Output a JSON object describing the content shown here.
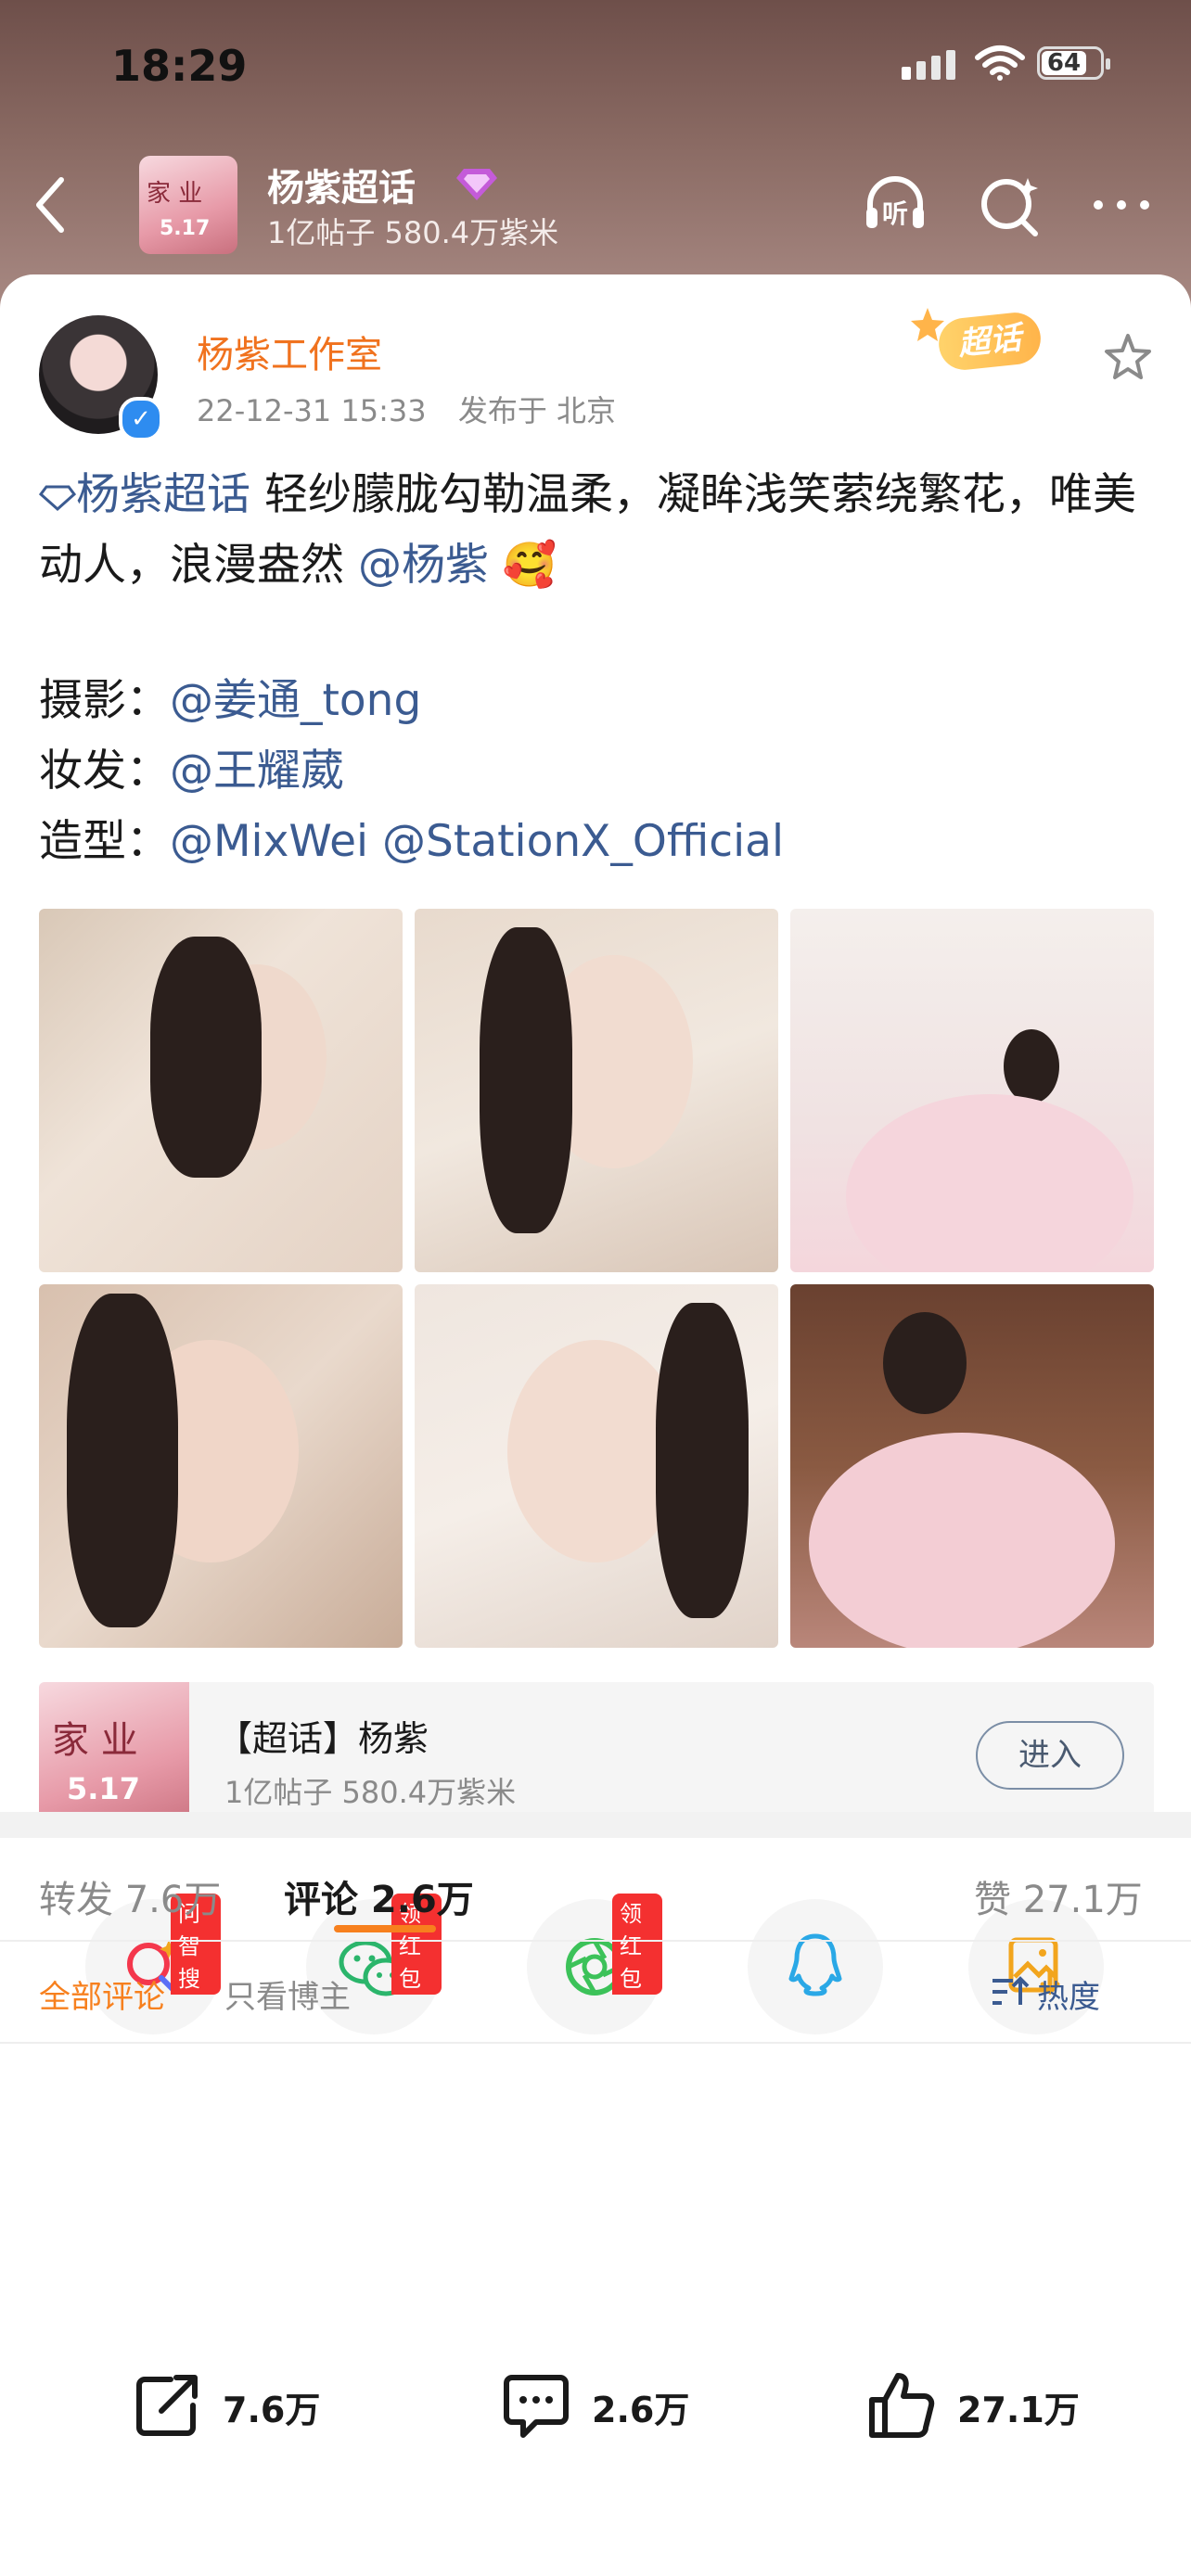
{
  "status_bar": {
    "time": "18:29",
    "battery": "64"
  },
  "header": {
    "title": "杨紫超话",
    "subtitle": "1亿帖子 580.4万紫米",
    "avatar_text_1": "家 业",
    "avatar_text_2": "5.17"
  },
  "post": {
    "author": "杨紫工作室",
    "timestamp": "22-12-31 15:33",
    "location": "发布于 北京",
    "badge": "超话",
    "topic_link": "杨紫超话",
    "text_main": " 轻纱朦胧勾勒温柔，凝眸浅笑萦绕繁花，唯美动人，浪漫盎然 ",
    "mention_main": "@杨紫",
    "emoji": "🥰",
    "credits": [
      {
        "label": "摄影：",
        "value": "@姜通_tong"
      },
      {
        "label": "妆发：",
        "value": "@王耀葳"
      },
      {
        "label": "造型：",
        "value": "@MixWei @StationX_Official"
      }
    ]
  },
  "topic_card": {
    "title": "【超话】杨紫",
    "subtitle": "1亿帖子 580.4万紫米",
    "button": "进入",
    "thumb_text_1": "家 业",
    "thumb_text_2": "5.17"
  },
  "share": [
    {
      "tag": "问智搜",
      "icon": "ai-search-icon",
      "color": "#f4374c"
    },
    {
      "tag": "领红包",
      "icon": "wechat-icon",
      "color": "#2bb56b"
    },
    {
      "tag": "领红包",
      "icon": "moments-icon",
      "color": "#3cc259"
    },
    {
      "tag": "",
      "icon": "qq-icon",
      "color": "#2aa8e6"
    },
    {
      "tag": "",
      "icon": "save-image-icon",
      "color": "#f2a51d"
    }
  ],
  "tabs": {
    "repost": "转发 7.6万",
    "comments": "评论 2.6万",
    "likes": "赞 27.1万"
  },
  "filters": {
    "all": "全部评论",
    "author_only": "只看博主",
    "sort": "热度"
  },
  "bottom_bar": {
    "repost": "7.6万",
    "comment": "2.6万",
    "like": "27.1万"
  },
  "colors": {
    "accent": "#f7801e",
    "link": "#3b5b91",
    "author": "#f0721e"
  }
}
